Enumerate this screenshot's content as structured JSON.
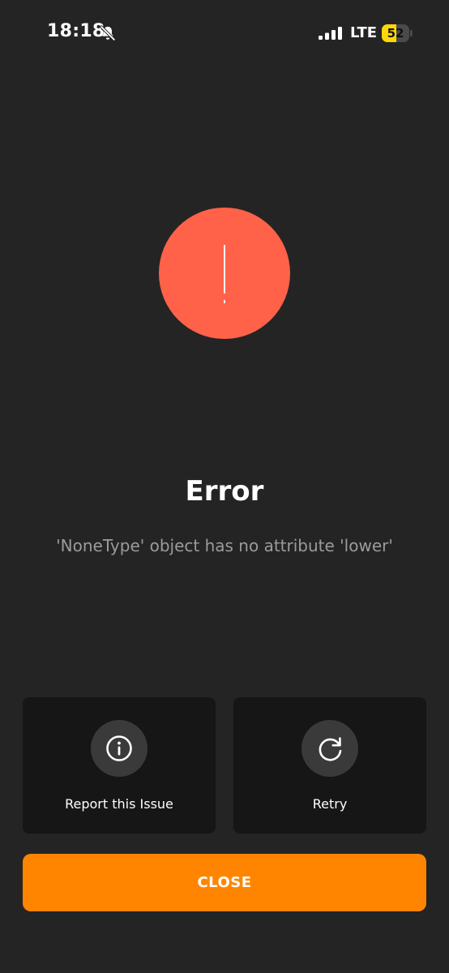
{
  "status_bar": {
    "time": "18:18",
    "network": "LTE",
    "battery_level": "52",
    "battery_fraction": 0.52,
    "icons": {
      "silent": "bell-slash-icon",
      "signal": "signal-bars-icon",
      "battery": "battery-icon"
    }
  },
  "alert": {
    "icon": "exclamation-icon",
    "color": "#ff6248"
  },
  "error": {
    "title": "Error",
    "message": "'NoneType' object has no attribute 'lower'"
  },
  "actions": [
    {
      "label": "Report this Issue",
      "icon": "info-icon"
    },
    {
      "label": "Retry",
      "icon": "retry-icon"
    }
  ],
  "close_button": {
    "label": "CLOSE",
    "color": "#ff8500"
  },
  "colors": {
    "background": "#242424",
    "card": "#161616",
    "icon_circle": "#3a3a3a",
    "message_text": "#9b9b9b",
    "battery": "#ffd60a"
  }
}
